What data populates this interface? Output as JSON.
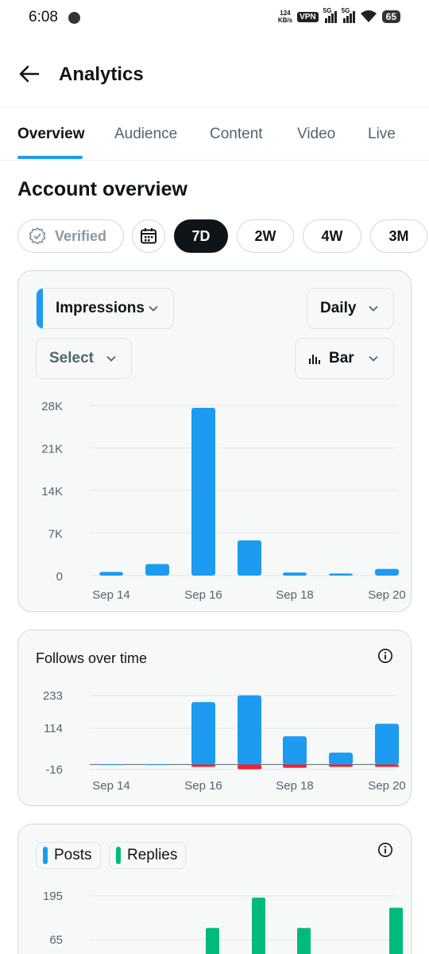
{
  "status_bar": {
    "time": "6:08",
    "speed_top": "124",
    "speed_unit": "KB/s",
    "vpn": "VPN",
    "net1": "5G",
    "net2": "5G",
    "battery": "65"
  },
  "header": {
    "title": "Analytics"
  },
  "tabs": [
    {
      "label": "Overview",
      "active": true
    },
    {
      "label": "Audience",
      "active": false
    },
    {
      "label": "Content",
      "active": false
    },
    {
      "label": "Video",
      "active": false
    },
    {
      "label": "Live",
      "active": false
    }
  ],
  "section_title": "Account overview",
  "filters": {
    "verified": "Verified",
    "ranges": [
      "7D",
      "2W",
      "4W",
      "3M"
    ],
    "active_range": "7D"
  },
  "impressions_card": {
    "metric_dropdown": "Impressions",
    "interval_dropdown": "Daily",
    "compare_dropdown": "Select",
    "chart_type_dropdown": "Bar"
  },
  "follows_card": {
    "title": "Follows over time"
  },
  "posts_card": {
    "legend": [
      "Posts",
      "Replies"
    ]
  },
  "colors": {
    "accent_blue": "#1d9bf0",
    "negative_red": "#f4212e",
    "replies_green": "#00ba7c"
  },
  "chart_data": [
    {
      "type": "bar",
      "categories": [
        "Sep 14",
        "Sep 15",
        "Sep 16",
        "Sep 17",
        "Sep 18",
        "Sep 19",
        "Sep 20"
      ],
      "x_tick_labels": [
        "Sep 14",
        "Sep 16",
        "Sep 18",
        "Sep 20"
      ],
      "y_tick_labels": [
        "28K",
        "21K",
        "14K",
        "7K",
        "0"
      ],
      "ylim": [
        0,
        28000
      ],
      "series": [
        {
          "name": "Impressions",
          "values": [
            600,
            1900,
            27600,
            5800,
            500,
            350,
            1100
          ]
        }
      ],
      "grid": true
    },
    {
      "type": "bar",
      "categories": [
        "Sep 14",
        "Sep 15",
        "Sep 16",
        "Sep 17",
        "Sep 18",
        "Sep 19",
        "Sep 20"
      ],
      "x_tick_labels": [
        "Sep 14",
        "Sep 16",
        "Sep 18",
        "Sep 20"
      ],
      "y_tick_labels": [
        "233",
        "114",
        "-16"
      ],
      "ylim": [
        -16,
        233
      ],
      "series": [
        {
          "values": [
            1,
            1,
            210,
            233,
            95,
            40,
            137
          ]
        },
        {
          "values": [
            0,
            0,
            -5,
            -16,
            -11,
            -7,
            -6
          ]
        }
      ],
      "grid": true
    },
    {
      "type": "bar",
      "categories": [
        "Sep 14",
        "Sep 15",
        "Sep 16",
        "Sep 17",
        "Sep 18",
        "Sep 19",
        "Sep 20"
      ],
      "y_tick_labels": [
        "195",
        "65"
      ],
      "series": [
        {
          "name": "Posts",
          "values": [
            0,
            0,
            0,
            0,
            0,
            6,
            0
          ]
        },
        {
          "name": "Replies",
          "values": [
            0,
            0,
            100,
            190,
            100,
            0,
            160
          ]
        }
      ],
      "grid": true
    }
  ]
}
